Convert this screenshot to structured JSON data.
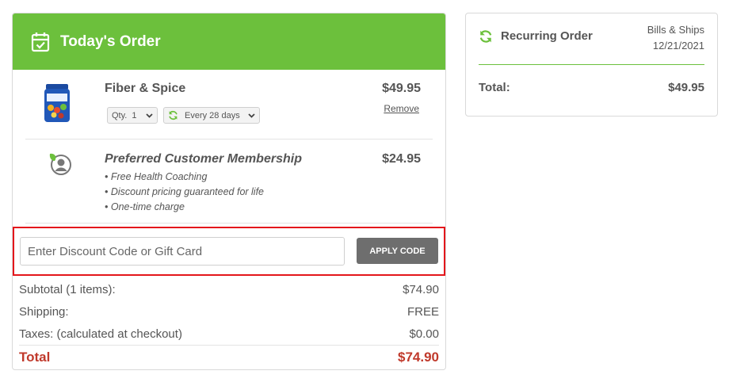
{
  "order": {
    "title": "Today's Order",
    "items": [
      {
        "name": "Fiber & Spice",
        "price": "$49.95",
        "remove_label": "Remove",
        "qty_label": "Qty.",
        "qty_value": "1",
        "frequency": "Every 28 days"
      }
    ],
    "membership": {
      "name": "Preferred Customer Membership",
      "price": "$24.95",
      "bullets": [
        "• Free Health Coaching",
        "• Discount pricing guaranteed for life",
        "• One-time charge"
      ]
    },
    "discount": {
      "placeholder": "Enter Discount Code or Gift Card",
      "button_label": "APPLY CODE"
    },
    "totals": {
      "subtotal_label": "Subtotal (1 items):",
      "subtotal_value": "$74.90",
      "shipping_label": "Shipping:",
      "shipping_value": "FREE",
      "taxes_label": "Taxes: (calculated at checkout)",
      "taxes_value": "$0.00",
      "total_label": "Total",
      "total_value": "$74.90"
    }
  },
  "recurring": {
    "title": "Recurring Order",
    "bills_label": "Bills & Ships",
    "date": "12/21/2021",
    "total_label": "Total:",
    "total_value": "$49.95"
  },
  "colors": {
    "brand_green": "#6cc03c",
    "highlight_red": "#e4161b",
    "total_red": "#c0392b",
    "button_gray": "#6e6e6e"
  },
  "icons": {
    "header": "calendar-check-icon",
    "frequency": "sync-icon",
    "recurring": "sync-icon",
    "membership": "leaf-person-icon",
    "dropdown": "chevron-down-icon"
  }
}
